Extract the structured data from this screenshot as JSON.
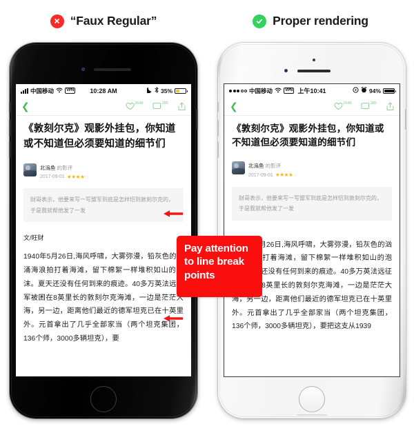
{
  "headers": {
    "left": {
      "label": "“Faux Regular”",
      "icon": "x-circle-icon",
      "color": "#FB2B28"
    },
    "right": {
      "label": "Proper rendering",
      "icon": "check-circle-icon",
      "color": "#33D15F"
    }
  },
  "callout": {
    "text": "Pay attention to line break points",
    "color": "#FA0E0E"
  },
  "phones": {
    "left": {
      "frame_color": "jet-black",
      "status": {
        "carrier": "中国移动",
        "network": "VPN",
        "time": "10:28 AM",
        "battery_pct": "35%",
        "moon_icon": "crescent-moon-icon",
        "bluetooth_icon": "bluetooth-icon",
        "wifi_icon": "wifi-icon",
        "signal_style": "bars"
      },
      "nav": {
        "back_icon": "chevron-left-icon",
        "like_icon": "heart-icon",
        "like_count": "2648",
        "comment_icon": "comment-icon",
        "comment_count": "285",
        "share_icon": "share-icon"
      },
      "article": {
        "title": "《敦刻尔克》观影外挂包，你知道或不知道但必须要知道的细节们",
        "author": "北溩鱼",
        "author_suffix": "的影评",
        "date": "2017-09-01",
        "rating_filled": "★★★★",
        "rating_empty": "☆",
        "quote": "财哥表示，他要来写一写盟军到底是怎样怊到敦刻尔克的，于是我就帮他发了一发",
        "writer_line": "文/旺财",
        "body": "1940年5月26日,海风呼啸，大雾弥漫，铅灰色的汹涌海浪拍打着海滩，留下棉絮一样堆积如山的泡沫。夏天还没有任何到来的痕迹。40多万英法远征军被困在8英里长的敦刻尔克海滩，一边是茫茫大海，另一边，距离他们最近的德军坦克已在十英里外。元首拿出了几乎全部家当（两个坦克集团，136个师，3000多辆坦克），要"
      }
    },
    "right": {
      "frame_color": "silver-white",
      "status": {
        "carrier": "中国移动",
        "network": "VPN",
        "time": "上午10:41",
        "battery_pct": "94%",
        "alarm_icon": "alarm-clock-icon",
        "rotation_icon": "rotation-lock-icon",
        "wifi_icon": "wifi-icon",
        "signal_style": "dots"
      },
      "nav": {
        "back_icon": "chevron-left-icon",
        "like_icon": "heart-icon",
        "like_count": "2648",
        "comment_icon": "comment-icon",
        "comment_count": "285",
        "share_icon": "share-icon"
      },
      "article": {
        "title": "《敦刻尔克》观影外挂包，你知道或不知道但必须要知道的细节们",
        "author": "北溩鱼",
        "author_suffix": "的影评",
        "date": "2017-09-01",
        "rating_filled": "★★★★",
        "rating_empty": "☆",
        "quote": "财哥表示，他要来写一写盟军到底是怎样怊到敦刻尔克的，于是我就帮他发了一发",
        "writer_line": "",
        "body": "1940年5月26日,海风呼啸，大雾弥漫，铅灰色的汹涌海浪拍打着海滩，留下棉絮一样堆积如山的泡沫。夏天还没有任何到来的痕迹。40多万英法远征军被困在8英里长的敦刻尔克海滩，一边是茫茫大海，另一边，距离他们最近的德军坦克已在十英里外。元首拿出了几乎全部家当（两个坦克集团，136个师，3000多辆坦克），要把这支从1939"
      }
    }
  }
}
